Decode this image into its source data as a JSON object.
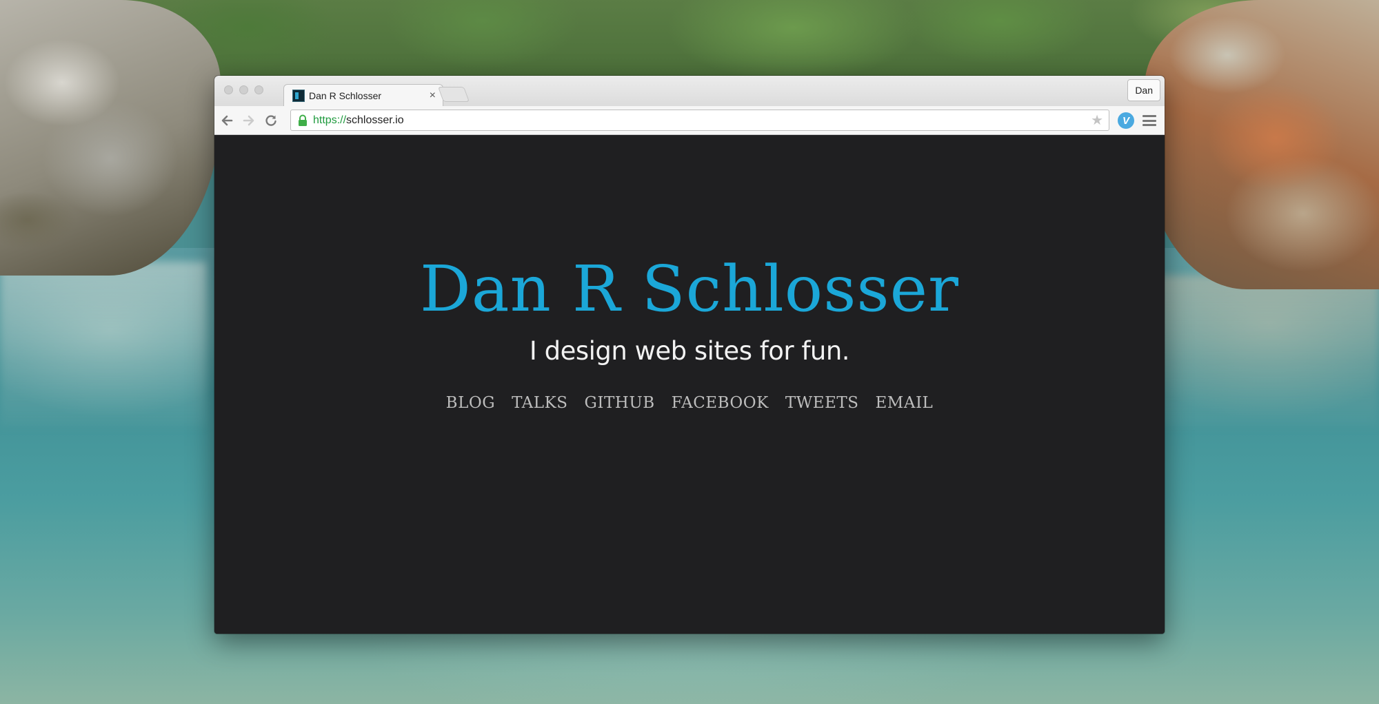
{
  "browser": {
    "tab": {
      "title": "Dan R Schlosser",
      "close_label": "×"
    },
    "profile_button": "Dan",
    "address_bar": {
      "scheme": "https://",
      "host": "schlosser.io"
    },
    "icons": {
      "back": "back-arrow-icon",
      "forward": "forward-arrow-icon",
      "reload": "reload-icon",
      "lock": "lock-icon",
      "bookmark": "star-icon",
      "extension": "extension-icon",
      "menu": "hamburger-menu-icon"
    }
  },
  "site": {
    "title": "Dan R Schlosser",
    "tagline": "I design web sites for fun.",
    "nav": [
      "BLOG",
      "TALKS",
      "GITHUB",
      "FACEBOOK",
      "TWEETS",
      "EMAIL"
    ]
  },
  "colors": {
    "page_background": "#1f1f21",
    "title": "#1ba7d8",
    "tagline": "#f2f2f2",
    "nav_links": "#bdbdbd",
    "url_scheme": "#1f9a3e"
  }
}
